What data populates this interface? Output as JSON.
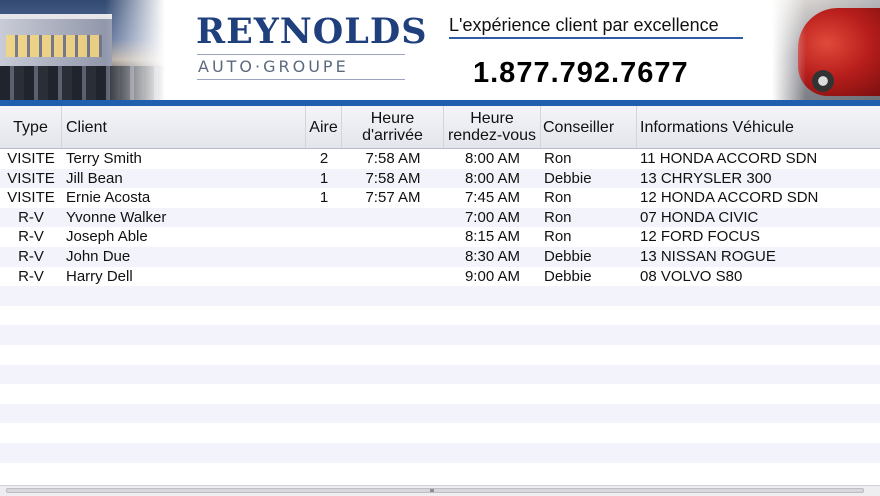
{
  "header": {
    "brand": "REYNOLDS",
    "brand_sub": "AUTO·GROUPE",
    "tagline": "L'expérience client par excellence",
    "phone": "1.877.792.7677",
    "accent_color": "#1f5fae",
    "brand_color": "#1f3f7d"
  },
  "table": {
    "columns": [
      {
        "key": "type",
        "label": "Type"
      },
      {
        "key": "client",
        "label": "Client"
      },
      {
        "key": "aire",
        "label": "Aire"
      },
      {
        "key": "arrivee",
        "label": "Heure d'arrivée"
      },
      {
        "key": "rdv",
        "label": "Heure rendez-vous"
      },
      {
        "key": "conseiller",
        "label": "Conseiller"
      },
      {
        "key": "vehicule",
        "label": "Informations Véhicule"
      }
    ],
    "rows": [
      {
        "type": "VISITE",
        "client": "Terry Smith",
        "aire": "2",
        "arrivee": "7:58 AM",
        "rdv": "8:00 AM",
        "conseiller": "Ron",
        "vehicule": "11 HONDA ACCORD SDN"
      },
      {
        "type": "VISITE",
        "client": "Jill Bean",
        "aire": "1",
        "arrivee": "7:58 AM",
        "rdv": "8:00 AM",
        "conseiller": "Debbie",
        "vehicule": "13 CHRYSLER 300"
      },
      {
        "type": "VISITE",
        "client": "Ernie Acosta",
        "aire": "1",
        "arrivee": "7:57 AM",
        "rdv": "7:45 AM",
        "conseiller": "Ron",
        "vehicule": "12 HONDA ACCORD SDN"
      },
      {
        "type": "R-V",
        "client": "Yvonne Walker",
        "aire": "",
        "arrivee": "",
        "rdv": "7:00 AM",
        "conseiller": "Ron",
        "vehicule": "07 HONDA CIVIC"
      },
      {
        "type": "R-V",
        "client": "Joseph Able",
        "aire": "",
        "arrivee": "",
        "rdv": "8:15 AM",
        "conseiller": "Ron",
        "vehicule": "12 FORD FOCUS"
      },
      {
        "type": "R-V",
        "client": "John Due",
        "aire": "",
        "arrivee": "",
        "rdv": "8:30 AM",
        "conseiller": "Debbie",
        "vehicule": "13 NISSAN ROGUE"
      },
      {
        "type": "R-V",
        "client": "Harry Dell",
        "aire": "",
        "arrivee": "",
        "rdv": "9:00 AM",
        "conseiller": "Debbie",
        "vehicule": "08 VOLVO S80"
      }
    ],
    "stripe_color": "#f2f3fb"
  }
}
